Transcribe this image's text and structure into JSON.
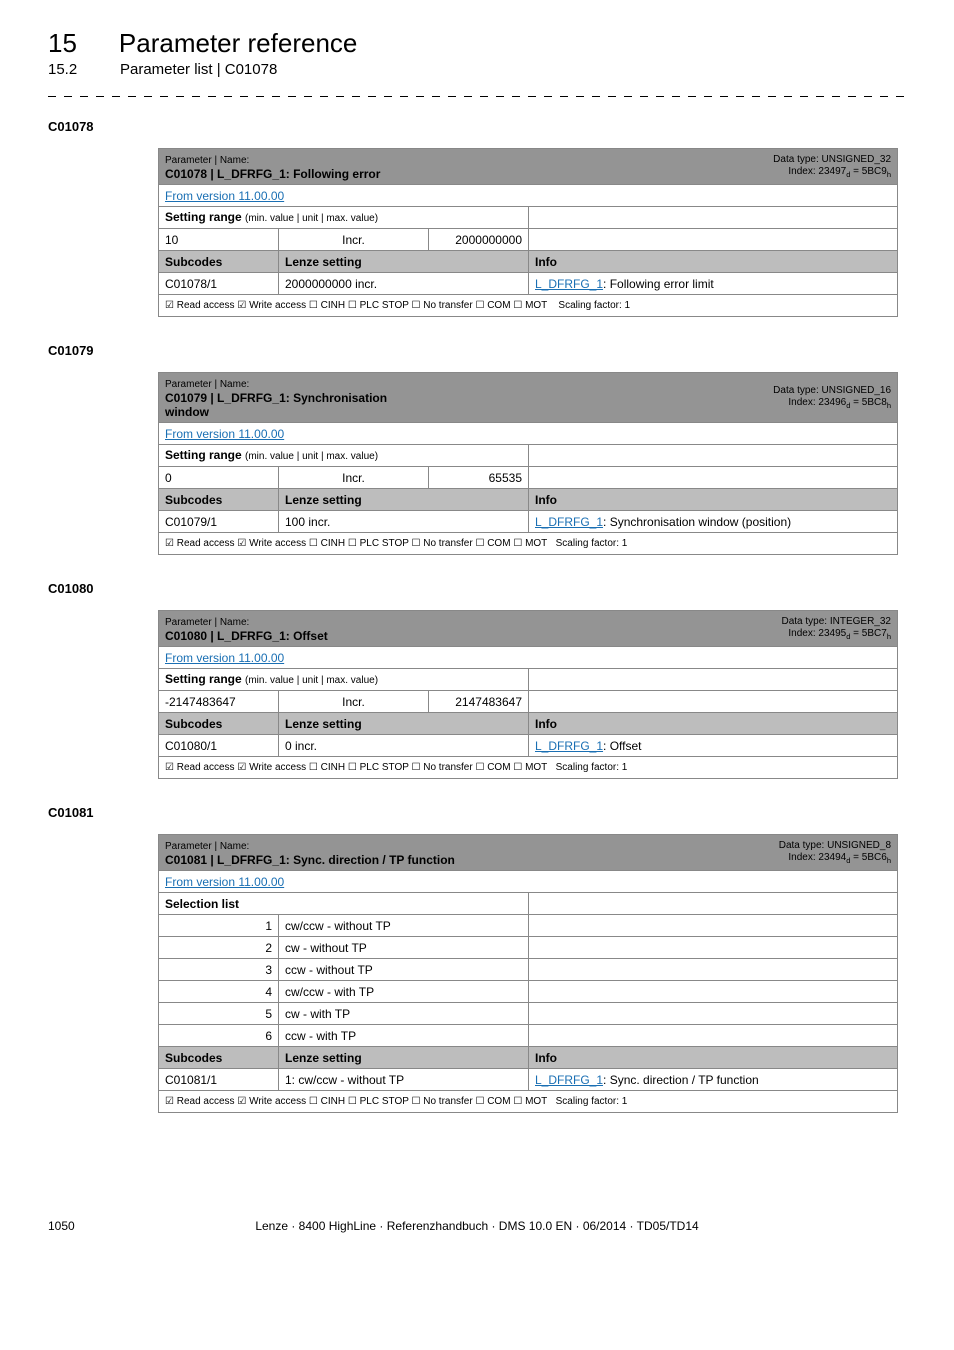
{
  "chapter": {
    "num": "15",
    "title": "Parameter reference"
  },
  "subchapter": {
    "num": "15.2",
    "title": "Parameter list | C01078"
  },
  "labels": {
    "param_name": "Parameter | Name:",
    "from_version": "From version 11.00.00",
    "setting_range": "Setting range (min. value | unit | max. value)",
    "selection_list": "Selection list",
    "subcodes": "Subcodes",
    "lenze_setting": "Lenze setting",
    "info": "Info",
    "access_row": "☑ Read access   ☑ Write access   ☐ CINH   ☐ PLC STOP   ☐ No transfer   ☐ COM   ☐ MOT",
    "scaling": "Scaling factor: 1"
  },
  "t1": {
    "anchor": "C01078",
    "name": "C01078 | L_DFRFG_1: Following error",
    "datatype": "Data type: UNSIGNED_32",
    "index_pre": "Index: 23497",
    "index_suf": " = 5BC9",
    "min": "10",
    "unit": "Incr.",
    "max": "2000000000",
    "subcode": "C01078/1",
    "setting": "2000000000 incr.",
    "info_link": "L_DFRFG_1",
    "info_rest": ": Following error limit"
  },
  "t2": {
    "anchor": "C01079",
    "name": "C01079 | L_DFRFG_1: Synchronisation window",
    "datatype": "Data type: UNSIGNED_16",
    "index_pre": "Index: 23496",
    "index_suf": " = 5BC8",
    "min": "0",
    "unit": "Incr.",
    "max": "65535",
    "subcode": "C01079/1",
    "setting": "100 incr.",
    "info_link": "L_DFRFG_1",
    "info_rest": ": Synchronisation window (position)"
  },
  "t3": {
    "anchor": "C01080",
    "name": "C01080 | L_DFRFG_1: Offset",
    "datatype": "Data type: INTEGER_32",
    "index_pre": "Index: 23495",
    "index_suf": " = 5BC7",
    "min": "-2147483647",
    "unit": "Incr.",
    "max": "2147483647",
    "subcode": "C01080/1",
    "setting": "0 incr.",
    "info_link": "L_DFRFG_1",
    "info_rest": ": Offset"
  },
  "t4": {
    "anchor": "C01081",
    "name": "C01081 | L_DFRFG_1: Sync. direction / TP function",
    "datatype": "Data type: UNSIGNED_8",
    "index_pre": "Index: 23494",
    "index_suf": " = 5BC6",
    "rows": [
      {
        "n": "1",
        "t": "cw/ccw - without TP"
      },
      {
        "n": "2",
        "t": "cw - without TP"
      },
      {
        "n": "3",
        "t": "ccw - without TP"
      },
      {
        "n": "4",
        "t": "cw/ccw - with TP"
      },
      {
        "n": "5",
        "t": "cw - with TP"
      },
      {
        "n": "6",
        "t": "ccw - with TP"
      }
    ],
    "subcode": "C01081/1",
    "setting": "1: cw/ccw - without TP",
    "info_link": "L_DFRFG_1",
    "info_rest": ": Sync. direction / TP function"
  },
  "footer": {
    "page": "1050",
    "text": "Lenze · 8400 HighLine · Referenzhandbuch · DMS 10.0 EN · 06/2014 · TD05/TD14"
  }
}
